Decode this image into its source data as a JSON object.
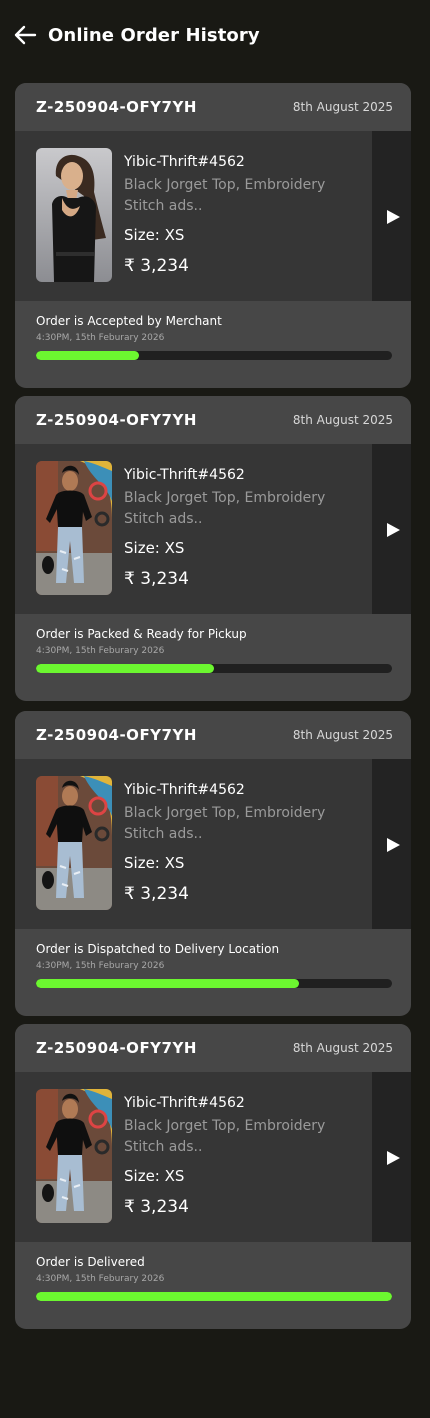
{
  "header": {
    "title": "Online Order History"
  },
  "orders": [
    {
      "order_id": "Z-250904-OFY7YH",
      "date": "8th August 2025",
      "store": "Yibic-Thrift#4562",
      "description": "Black Jorget Top, Embroidery Stitch ads..",
      "size": "Size: XS",
      "price": "₹ 3,234",
      "status": "Order is Accepted by Merchant",
      "status_time": "4:30PM, 15th Feburary 2026",
      "progress": 0.29
    },
    {
      "order_id": "Z-250904-OFY7YH",
      "date": "8th August 2025",
      "store": "Yibic-Thrift#4562",
      "description": "Black Jorget Top, Embroidery Stitch ads..",
      "size": "Size: XS",
      "price": "₹ 3,234",
      "status": "Order is Packed & Ready for Pickup",
      "status_time": "4:30PM, 15th Feburary 2026",
      "progress": 0.5
    },
    {
      "order_id": "Z-250904-OFY7YH",
      "date": "8th August 2025",
      "store": "Yibic-Thrift#4562",
      "description": "Black Jorget Top, Embroidery Stitch ads..",
      "size": "Size: XS",
      "price": "₹ 3,234",
      "status": "Order is Dispatched to Delivery Location",
      "status_time": "4:30PM, 15th Feburary 2026",
      "progress": 0.74
    },
    {
      "order_id": "Z-250904-OFY7YH",
      "date": "8th August 2025",
      "store": "Yibic-Thrift#4562",
      "description": "Black Jorget Top, Embroidery Stitch ads..",
      "size": "Size: XS",
      "price": "₹ 3,234",
      "status": "Order is Delivered",
      "status_time": "4:30PM, 15th Feburary 2026",
      "progress": 1.0
    }
  ],
  "colors": {
    "background": "#191914",
    "card": "#474747",
    "card_body": "#363636",
    "progress_fill": "#6cf730",
    "progress_track": "#202020"
  },
  "icons": {
    "back": "left-arrow-icon",
    "open": "play-arrow-icon"
  }
}
